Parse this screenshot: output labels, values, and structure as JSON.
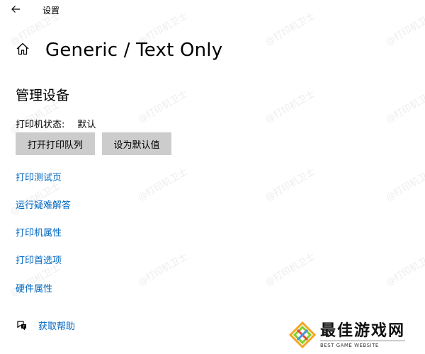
{
  "window": {
    "title": "设置"
  },
  "header": {
    "title": "Generic / Text Only"
  },
  "manage": {
    "section_title": "管理设备",
    "status_label": "打印机状态:",
    "status_value": "默认",
    "buttons": {
      "open_queue": "打开打印队列",
      "set_default": "设为默认值"
    }
  },
  "links": [
    {
      "label": "打印测试页"
    },
    {
      "label": "运行疑难解答"
    },
    {
      "label": "打印机属性"
    },
    {
      "label": "打印首选项"
    },
    {
      "label": "硬件属性"
    }
  ],
  "help": {
    "label": "获取帮助"
  },
  "watermark": {
    "text": "@打印机卫士"
  },
  "brand": {
    "name": "最佳游戏网",
    "tagline": "BEST GAME WEBSITE"
  },
  "colors": {
    "link": "#0067c0",
    "button_bg": "#cccccc",
    "background": "#ffffff"
  },
  "icons": [
    "back-arrow-icon",
    "home-icon",
    "help-chat-icon"
  ]
}
